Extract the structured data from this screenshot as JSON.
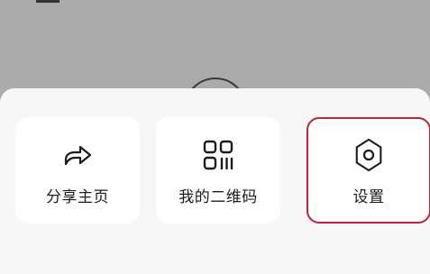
{
  "share_sheet": {
    "items": [
      {
        "label": "分享主页",
        "icon": "share-arrow-icon"
      },
      {
        "label": "我的二维码",
        "icon": "qr-code-icon"
      },
      {
        "label": "设置",
        "icon": "hexagon-settings-icon"
      }
    ],
    "highlight_color": "#c3233a"
  }
}
